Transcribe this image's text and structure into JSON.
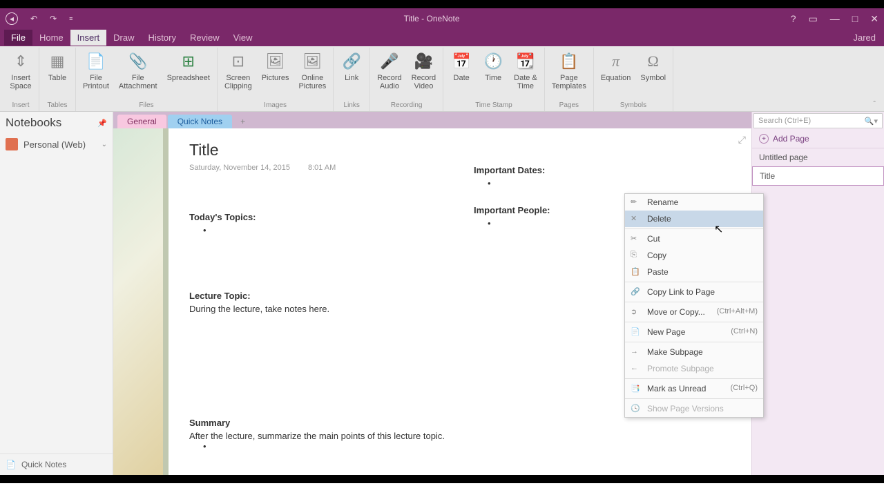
{
  "titlebar": {
    "title": "Title - OneNote"
  },
  "menubar": {
    "file": "File",
    "home": "Home",
    "insert": "Insert",
    "draw": "Draw",
    "history": "History",
    "review": "Review",
    "view": "View",
    "user": "Jared"
  },
  "ribbon": {
    "insert_space": "Insert\nSpace",
    "table": "Table",
    "file_printout": "File\nPrintout",
    "file_attachment": "File\nAttachment",
    "spreadsheet": "Spreadsheet",
    "screen_clipping": "Screen\nClipping",
    "pictures": "Pictures",
    "online_pictures": "Online\nPictures",
    "link": "Link",
    "record_audio": "Record\nAudio",
    "record_video": "Record\nVideo",
    "date": "Date",
    "time": "Time",
    "date_time": "Date &\nTime",
    "page_templates": "Page\nTemplates",
    "equation": "Equation",
    "symbol": "Symbol",
    "groups": {
      "insert": "Insert",
      "tables": "Tables",
      "files": "Files",
      "images": "Images",
      "links": "Links",
      "recording": "Recording",
      "timestamp": "Time Stamp",
      "pages": "Pages",
      "symbols": "Symbols"
    }
  },
  "sidebar": {
    "header": "Notebooks",
    "notebook": "Personal (Web)",
    "quicknotes": "Quick Notes"
  },
  "sections": {
    "general": "General",
    "quick": "Quick Notes"
  },
  "rightpanel": {
    "search_placeholder": "Search (Ctrl+E)",
    "add_page": "Add Page",
    "pages": [
      "Untitled page",
      "Title"
    ]
  },
  "page": {
    "title": "Title",
    "date": "Saturday, November 14, 2015",
    "time": "8:01 AM",
    "important_dates": "Important Dates:",
    "todays_topics": "Today's Topics:",
    "important_people": "Important People:",
    "lecture_topic": "Lecture Topic:",
    "lecture_body": "During the lecture, take notes here.",
    "summary": "Summary",
    "summary_body": "After the lecture, summarize the main points of this lecture topic."
  },
  "context_menu": {
    "rename": "Rename",
    "delete": "Delete",
    "cut": "Cut",
    "copy": "Copy",
    "paste": "Paste",
    "copy_link": "Copy Link to Page",
    "move_copy": "Move or Copy...",
    "move_copy_key": "(Ctrl+Alt+M)",
    "new_page": "New Page",
    "new_page_key": "(Ctrl+N)",
    "make_subpage": "Make Subpage",
    "promote_subpage": "Promote Subpage",
    "mark_unread": "Mark as Unread",
    "mark_unread_key": "(Ctrl+Q)",
    "show_versions": "Show Page Versions"
  }
}
